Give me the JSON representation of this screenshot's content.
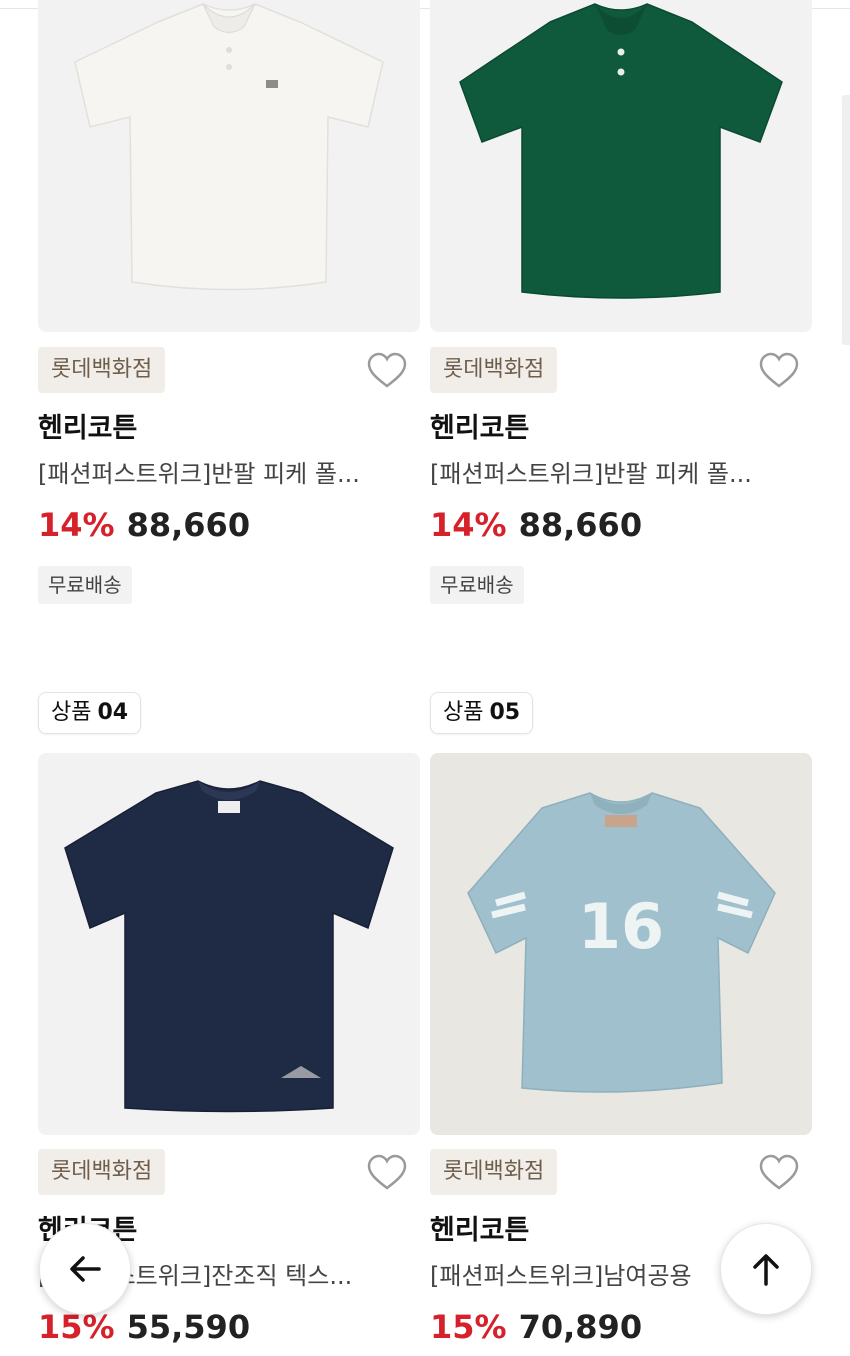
{
  "products": [
    {
      "badge": null,
      "store": "롯데백화점",
      "brand": "헨리코튼",
      "title": "[패션퍼스트위크]반팔 피케 폴...",
      "discount": "14%",
      "price": "88,660",
      "shipping": "무료배송",
      "shirt_color": "#f4f3ef"
    },
    {
      "badge": null,
      "store": "롯데백화점",
      "brand": "헨리코튼",
      "title": "[패션퍼스트위크]반팔 피케 폴...",
      "discount": "14%",
      "price": "88,660",
      "shipping": "무료배송",
      "shirt_color": "#0f5a3c"
    },
    {
      "badge_label": "상품",
      "badge_num": "04",
      "store": "롯데백화점",
      "brand": "헨리코튼",
      "title": "[패션퍼스트위크]잔조직 텍스...",
      "discount": "15%",
      "price": "55,590",
      "shirt_color": "#1f2a44"
    },
    {
      "badge_label": "상품",
      "badge_num": "05",
      "store": "롯데백화점",
      "brand": "헨리코튼",
      "title": "[패션퍼스트위크]남여공용",
      "discount": "15%",
      "price": "70,890",
      "shirt_color": "#9fc0cc",
      "print_number": "16"
    }
  ],
  "nav": {
    "back_icon": "arrow-left-icon",
    "top_icon": "arrow-up-icon"
  },
  "colors": {
    "discount": "#d6202a",
    "store_tag_bg": "#f1ede8",
    "store_tag_text": "#6f5e4b"
  }
}
